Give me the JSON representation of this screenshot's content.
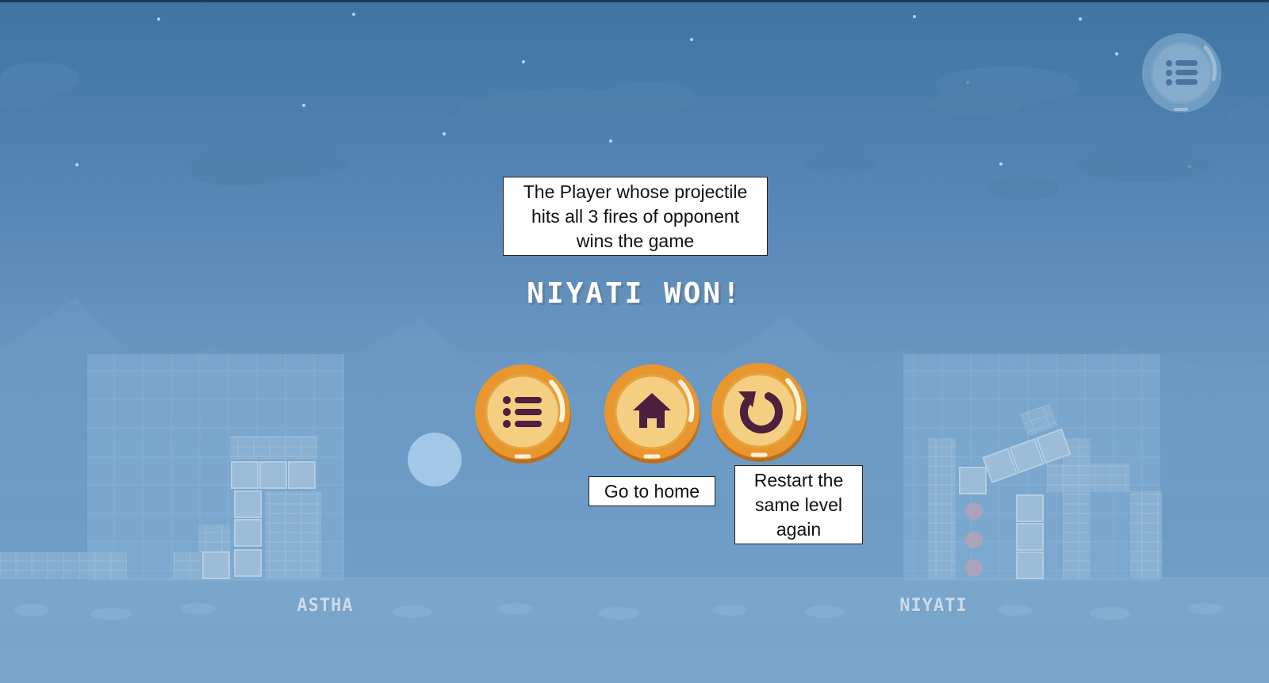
{
  "game": {
    "winner_text": "NIYATI WON!",
    "players": {
      "left": "ASTHA",
      "right": "NIYATI"
    }
  },
  "tooltips": {
    "rules": [
      "The Player whose projectile",
      "hits all 3 fires of opponent",
      "wins the game"
    ],
    "home": "Go to home",
    "restart": [
      "Restart the",
      "same level",
      "again"
    ]
  },
  "buttons": {
    "levels_icon": "list-icon",
    "home_icon": "home-icon",
    "restart_icon": "restart-icon",
    "corner_menu_icon": "list-icon"
  },
  "colors": {
    "button_orange": "#e9962f",
    "button_inner": "#f4cf82",
    "icon_purple": "#4e1f3f",
    "sky": "#5787b6"
  }
}
